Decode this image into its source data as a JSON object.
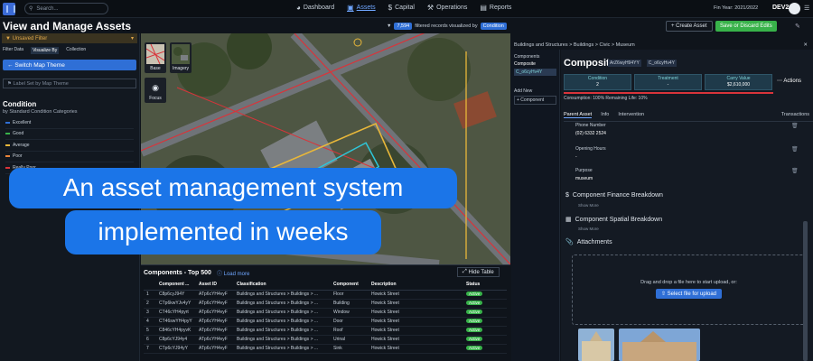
{
  "topbar": {
    "search_placeholder": "Search...",
    "nav": [
      {
        "label": "Dashboard",
        "icon": "speedometer-icon"
      },
      {
        "label": "Assets",
        "icon": "assets-icon"
      },
      {
        "label": "Capital",
        "icon": "dollar-icon"
      },
      {
        "label": "Operations",
        "icon": "wrench-icon"
      },
      {
        "label": "Reports",
        "icon": "report-icon"
      }
    ],
    "fin_year": "Fin Year: 2021/2022",
    "user": "DEV2"
  },
  "page": {
    "title": "View and Manage Assets",
    "filtered_count": "7,594",
    "filtered_text": "filtered records visualized by",
    "filtered_by": "Condition",
    "create_label": "+ Create Asset",
    "save_label": "Save or Discard Edits"
  },
  "left": {
    "unsaved": "Unsaved Filter",
    "tabs": [
      "Filter Data",
      "Visualize By",
      "Collection"
    ],
    "switch_theme": "Switch Map Theme",
    "label_set": "Label Set by Map Theme",
    "condition_title": "Condition",
    "condition_sub": "by Standard Condition Categories",
    "legend": [
      {
        "label": "Excellent",
        "color": "#2f6fd6"
      },
      {
        "label": "Good",
        "color": "#38b24a"
      },
      {
        "label": "Average",
        "color": "#e8b73a"
      },
      {
        "label": "Poor",
        "color": "#e8843a"
      },
      {
        "label": "Really Poor",
        "color": "#d9343a"
      }
    ]
  },
  "map": {
    "base_label": "Base",
    "imagery_label": "Imagery",
    "focus_label": "Focus"
  },
  "components": {
    "title": "Components - Top 500",
    "load_more": "Load more",
    "hide_table": "Hide Table",
    "headers": [
      "",
      "Component ...",
      "Asset ID",
      "Classification",
      "Component",
      "Description",
      "Status"
    ],
    "rows": [
      [
        "1",
        "C8p6cyJ94Y",
        "ATp6cYH4vyF",
        "Buildings and Structures > Buildings > ...",
        "Floor",
        "Howick Street",
        "Active"
      ],
      [
        "2",
        "CTp6kwYJv4yY",
        "ATp6cYH4vyF",
        "Buildings and Structures > Buildings > ...",
        "Building",
        "Howick Street",
        "Active"
      ],
      [
        "3",
        "CT46cYH4pyrt",
        "ATp6cYH4vyF",
        "Buildings and Structures > Buildings > ...",
        "Window",
        "Howick Street",
        "Active"
      ],
      [
        "4",
        "CT46swYH4pyY",
        "ATp6cYH4vyF",
        "Buildings and Structures > Buildings > ...",
        "Door",
        "Howick Street",
        "Active"
      ],
      [
        "5",
        "C846cYH4pyvK",
        "ATp6cYH4vyF",
        "Buildings and Structures > Buildings > ...",
        "Roof",
        "Howick Street",
        "Active"
      ],
      [
        "6",
        "C8p6cYJ94y4",
        "ATp6cYH4vyF",
        "Buildings and Structures > Buildings > ...",
        "Urinal",
        "Howick Street",
        "Active"
      ],
      [
        "7",
        "CTp6cYJ94yY",
        "ATp6cYH4vyF",
        "Buildings and Structures > Buildings > ...",
        "Sink",
        "Howick Street",
        "Active"
      ]
    ]
  },
  "detail": {
    "breadcrumb": "Buildings and Structures > Buildings > Civic > Museum",
    "tree_title": "Components",
    "tree_node": "Composite",
    "tree_id": "C_o6cyHv4Y",
    "add_new": "Add New",
    "add_component": "+ Component",
    "title": "Composite",
    "id1": "ArZ6wyH94YY",
    "id2": "C_o6cyHv4Y",
    "cards": [
      {
        "label": "Condition",
        "value": "2"
      },
      {
        "label": "Treatment",
        "value": "-"
      },
      {
        "label": "Carry Value",
        "value": "$2,610,000"
      }
    ],
    "actions": "Actions",
    "consumption": "Consumption: 100% Remaining Life: 10%",
    "tabs": [
      "Parent Asset",
      "Info",
      "Intervention",
      "Transactions"
    ],
    "fields": [
      {
        "label": "Phone Number",
        "value": "(02) 6332 2524"
      },
      {
        "label": "Opening Hours",
        "value": "-"
      },
      {
        "label": "Purpose",
        "value": "museum"
      }
    ],
    "finance": "Component Finance Breakdown",
    "spatial": "Component Spatial Breakdown",
    "show_more": "Show More",
    "attachments": "Attachments",
    "drop_text": "Drag and drop a file here to start upload, or:",
    "upload": "Select file for upload"
  },
  "caption": {
    "line1": "An asset management system",
    "line2": "implemented in weeks"
  }
}
